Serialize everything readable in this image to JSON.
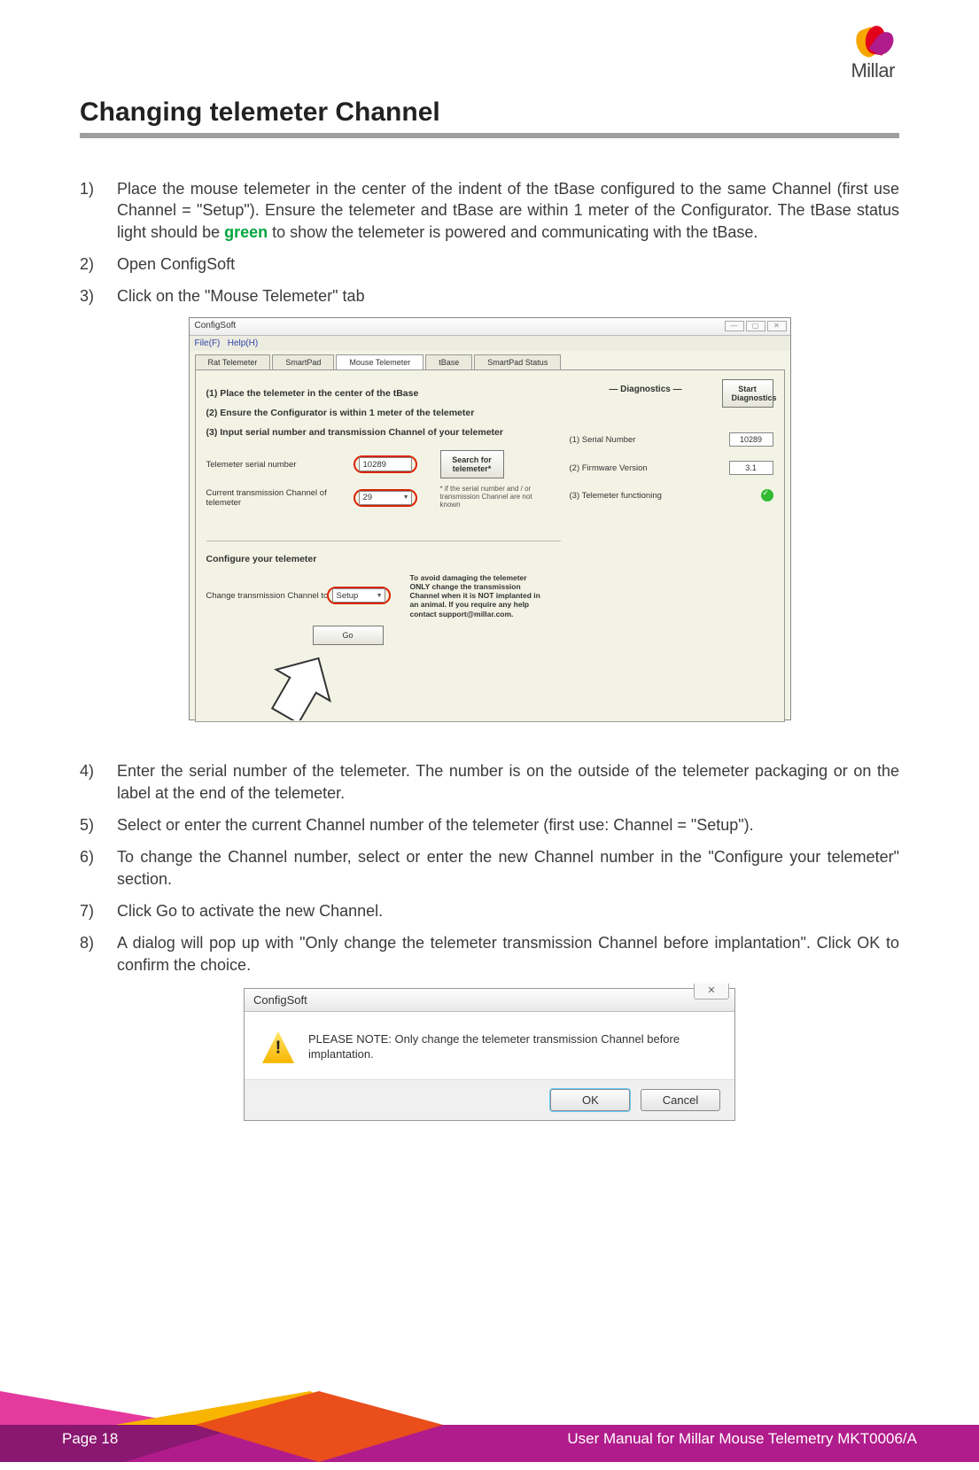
{
  "logo": {
    "text": "Millar"
  },
  "heading": "Changing telemeter Channel",
  "steps": {
    "s1a": "Place the mouse telemeter in the center of the indent of the tBase configured to the same Channel (first use Channel = \"Setup\").  Ensure the telemeter and tBase are within 1 meter of the Configurator. The tBase status light should be ",
    "s1green": "green",
    "s1b": " to show the telemeter is powered and communicating with the tBase.",
    "s2": "Open ConfigSoft",
    "s3": "Click on the \"Mouse Telemeter\" tab",
    "s4": "Enter the serial number of the telemeter.  The number is on the outside of the telemeter packaging or on the label at the end of the telemeter.",
    "s5": "Select or enter the current Channel number of the telemeter (first use: Channel = \"Setup\").",
    "s6": "To change the Channel number, select or enter the new Channel number in the \"Configure your telemeter\" section.",
    "s7": "Click Go to activate the new Channel.",
    "s8": "A dialog will pop up with \"Only change the telemeter transmission Channel before implantation\". Click OK to confirm the choice."
  },
  "shot1": {
    "title": "ConfigSoft",
    "menu1": "File(F)",
    "menu2": "Help(H)",
    "tabs": [
      "Rat Telemeter",
      "SmartPad",
      "Mouse Telemeter",
      "tBase",
      "SmartPad Status"
    ],
    "instr1": "(1) Place the telemeter in the center of the tBase",
    "instr2": "(2) Ensure the Configurator is within 1 meter of the telemeter",
    "instr3": "(3) Input serial number and transmission Channel of your telemeter",
    "lbl_serial": "Telemeter serial number",
    "val_serial": "10289",
    "lbl_chan": "Current transmission Channel of telemeter",
    "val_chan": "29",
    "btn_search": "Search for telemeter*",
    "note_search": "* if the serial number and / or transmission Channel are not known",
    "config_hdr": "Configure your telemeter",
    "lbl_chg": "Change transmission Channel to",
    "val_chg": "Setup",
    "btn_go": "Go",
    "warn": "To avoid damaging the telemeter ONLY change the transmission Channel when it is NOT implanted in an animal.  If you require any help contact support@millar.com.",
    "diag_hdr": "— Diagnostics —",
    "btn_diag": "Start Diagnostics",
    "dg1_l": "(1) Serial Number",
    "dg1_v": "10289",
    "dg2_l": "(2) Firmware Version",
    "dg2_v": "3.1",
    "dg3_l": "(3) Telemeter functioning"
  },
  "shot2": {
    "title": "ConfigSoft",
    "text": "PLEASE NOTE:  Only change the telemeter transmission Channel before implantation.",
    "ok": "OK",
    "cancel": "Cancel"
  },
  "footer": {
    "page": "Page 18",
    "right": "User Manual for Millar Mouse Telemetry MKT0006/A"
  }
}
